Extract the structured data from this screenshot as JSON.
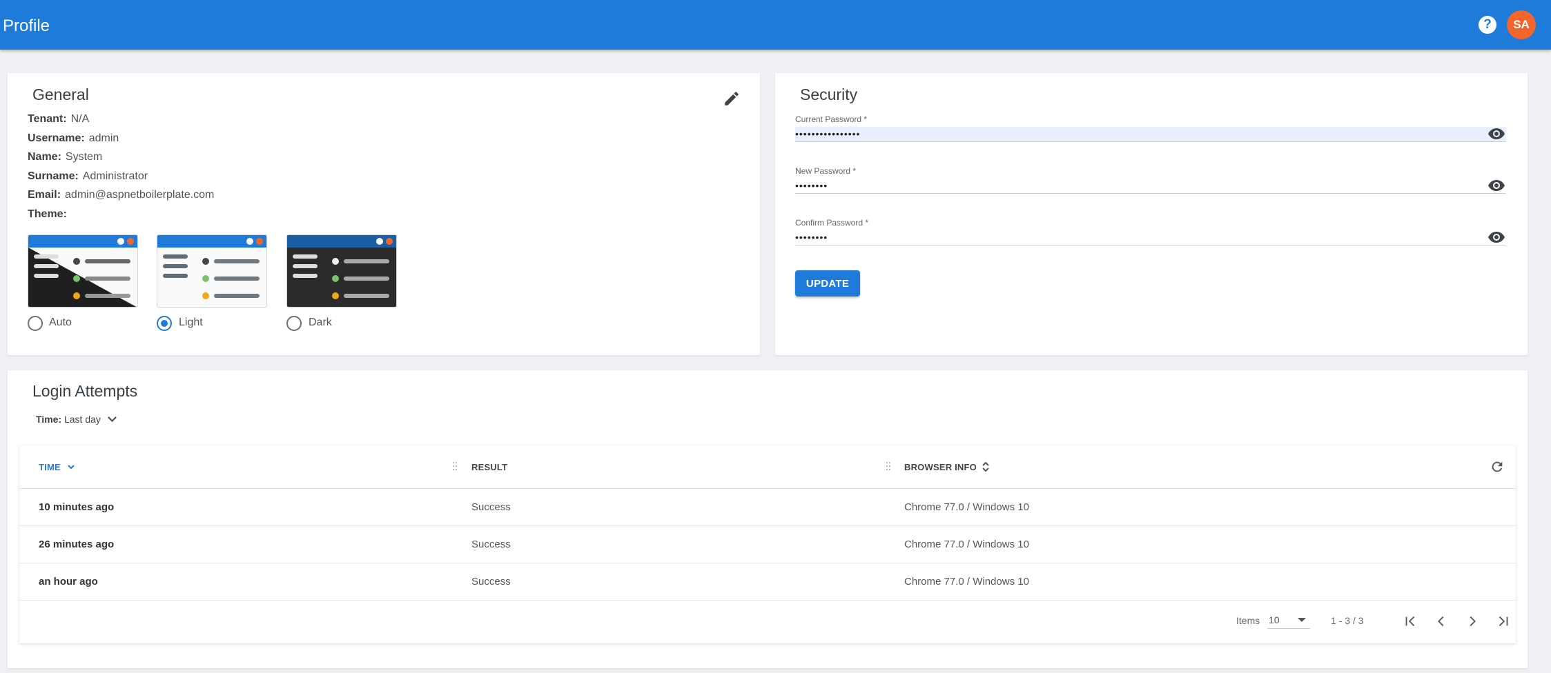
{
  "header": {
    "title": "Profile",
    "help_icon": "help-circle-icon",
    "avatar_initials": "SA",
    "colors": {
      "bar": "#1e7bd9",
      "avatar": "#f4652c"
    }
  },
  "general": {
    "title": "General",
    "edit_icon": "pencil-icon",
    "fields": [
      {
        "label": "Tenant:",
        "value": "N/A"
      },
      {
        "label": "Username:",
        "value": "admin"
      },
      {
        "label": "Name:",
        "value": "System"
      },
      {
        "label": "Surname:",
        "value": "Administrator"
      },
      {
        "label": "Email:",
        "value": "admin@aspnetboilerplate.com"
      },
      {
        "label": "Theme:",
        "value": ""
      }
    ],
    "themes": [
      {
        "label": "Auto",
        "selected": false
      },
      {
        "label": "Light",
        "selected": true
      },
      {
        "label": "Dark",
        "selected": false
      }
    ]
  },
  "security": {
    "title": "Security",
    "fields": [
      {
        "label": "Current Password *",
        "value": "••••••••••••••••",
        "icon": "eye-icon"
      },
      {
        "label": "New Password *",
        "value": "••••••••",
        "icon": "eye-icon"
      },
      {
        "label": "Confirm Password *",
        "value": "••••••••",
        "icon": "eye-icon"
      }
    ],
    "update_label": "UPDATE"
  },
  "login_attempts": {
    "title": "Login Attempts",
    "filter_label": "Time:",
    "filter_value": "Last day",
    "columns": [
      "TIME",
      "RESULT",
      "BROWSER INFO"
    ],
    "rows": [
      {
        "time": "10 minutes ago",
        "result": "Success",
        "browser": "Chrome 77.0 / Windows 10"
      },
      {
        "time": "26 minutes ago",
        "result": "Success",
        "browser": "Chrome 77.0 / Windows 10"
      },
      {
        "time": "an hour ago",
        "result": "Success",
        "browser": "Chrome 77.0 / Windows 10"
      }
    ],
    "pager": {
      "items_label": "Items",
      "page_size": "10",
      "range": "1 - 3 / 3"
    }
  }
}
